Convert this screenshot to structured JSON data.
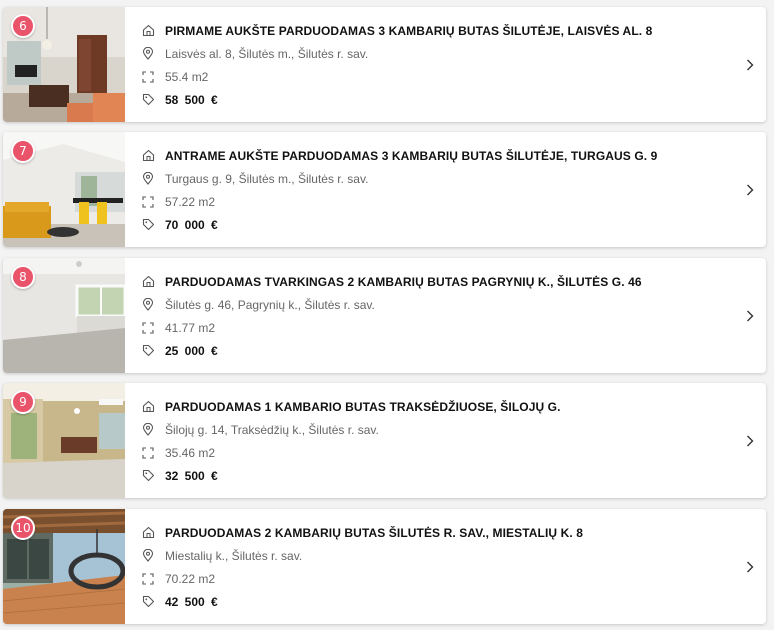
{
  "listings": [
    {
      "number": "6",
      "title": "PIRMAME AUKŠTE PARDUODAMAS 3 KAMBARIŲ BUTAS ŠILUTĖJE, LAISVĖS AL. 8",
      "address": "Laisvės al. 8, Šilutės m., Šilutės r. sav.",
      "area": "55.4 m2",
      "price": "58 500  €"
    },
    {
      "number": "7",
      "title": "ANTRAME AUKŠTE PARDUODAMAS 3 KAMBARIŲ BUTAS ŠILUTĖJE, TURGAUS G. 9",
      "address": "Turgaus g. 9, Šilutės m., Šilutės r. sav.",
      "area": "57.22 m2",
      "price": "70 000  €"
    },
    {
      "number": "8",
      "title": "PARDUODAMAS TVARKINGAS 2 KAMBARIŲ BUTAS PAGRYNIŲ K., ŠILUTĖS G. 46",
      "address": "Šilutės g. 46, Pagrynių k., Šilutės r. sav.",
      "area": "41.77 m2",
      "price": "25 000  €"
    },
    {
      "number": "9",
      "title": "PARDUODAMAS 1 KAMBARIO BUTAS TRAKSĖDŽIUOSE, ŠILOJŲ G.",
      "address": "Šilojų g. 14, Traksėdžių k., Šilutės r. sav.",
      "area": "35.46 m2",
      "price": "32 500  €"
    },
    {
      "number": "10",
      "title": "PARDUODAMAS 2 KAMBARIŲ BUTAS ŠILUTĖS R. SAV., MIESTALIŲ K. 8",
      "address": "Miestalių k., Šilutės r. sav.",
      "area": "70.22 m2",
      "price": "42 500  €"
    }
  ],
  "colors": {
    "badge": "#e9546b",
    "card": "#ffffff",
    "background": "#f3f3f3"
  },
  "icons": {
    "type": "home-icon",
    "address": "location-pin-icon",
    "area": "area-frame-icon",
    "price": "price-tag-icon",
    "open": "chevron-right-icon"
  }
}
